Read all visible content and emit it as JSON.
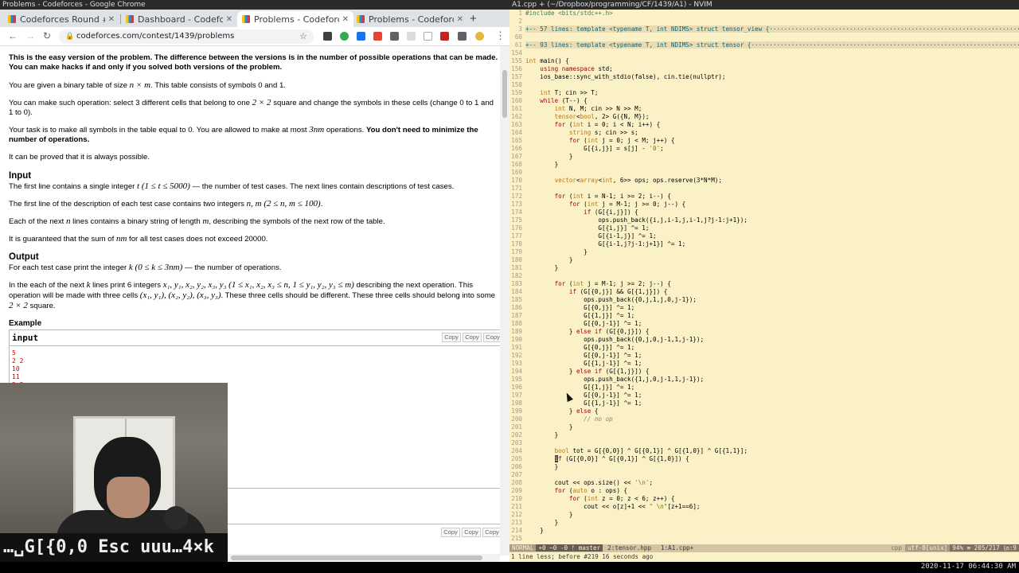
{
  "browser": {
    "window_title": "Problems - Codeforces - Google Chrome",
    "tabs": [
      {
        "label": "Codeforces Round #6",
        "active": false
      },
      {
        "label": "Dashboard - Codeforc",
        "active": false
      },
      {
        "label": "Problems - Codeforce",
        "active": true
      },
      {
        "label": "Problems - Codeforce",
        "active": false
      }
    ],
    "url": "codeforces.com/contest/1439/problems",
    "problem": {
      "p1": "This is the easy version of the problem. The difference between the versions is in the number of possible operations that can be made. You can make hacks if and only if you solved both versions of the problem.",
      "p2a": "You are given a binary table of size ",
      "p2m": "n × m",
      "p2b": ". This table consists of symbols 0 and 1.",
      "p3a": "You can make such operation: select 3 different cells that belong to one ",
      "p3m": "2 × 2",
      "p3b": " square and change the symbols in these cells (change 0 to 1 and 1 to 0).",
      "p4a": "Your task is to make all symbols in the table equal to 0. You are allowed to make at most ",
      "p4m": "3nm",
      "p4b": " operations. ",
      "p4c": "You don't need to minimize the number of operations.",
      "p5": "It can be proved that it is always possible.",
      "input_heading": "Input",
      "i1a": "The first line contains a single integer ",
      "i1m": "t (1 ≤ t ≤ 5000)",
      "i1b": " — the number of test cases. The next lines contain descriptions of test cases.",
      "i2a": "The first line of the description of each test case contains two integers ",
      "i2m": "n, m (2 ≤ n, m ≤ 100)",
      "i2b": ".",
      "i3a": "Each of the next ",
      "i3m": "n",
      "i3b": " lines contains a binary string of length ",
      "i3m2": "m",
      "i3c": ", describing the symbols of the next row of the table.",
      "i4a": "It is guaranteed that the sum of ",
      "i4m": "nm",
      "i4b": " for all test cases does not exceed 20000.",
      "output_heading": "Output",
      "o1a": "For each test case print the integer ",
      "o1m": "k (0 ≤ k ≤ 3nm)",
      "o1b": " — the number of operations.",
      "o2a": "In the each of the next ",
      "o2m": "k",
      "o2b": " lines print 6 integers ",
      "o2m2": "x₁, y₁, x₂, y₂, x₃, y₃ (1 ≤ x₁, x₂, x₃ ≤ n, 1 ≤ y₁, y₂, y₃ ≤ m)",
      "o2c": " describing the next operation. This operation will be made with three cells ",
      "o2m3": "(x₁, y₁), (x₂, y₂), (x₃, y₃)",
      "o2d": ". These three cells should be different. These three cells should belong into some ",
      "o2m4": "2 × 2",
      "o2e": " square.",
      "example_heading": "Example",
      "input_label": "input",
      "copy_label": "Copy",
      "input_lines": "5\n2 2\n10\n11\n3 3"
    }
  },
  "keycast": "…␣G[{0,0 Esc uuu…4×k",
  "nvim": {
    "window_title": "A1.cpp + (~/Dropbox/programming/CF/1439/A1) - NVIM",
    "statusline": {
      "mode": "NORMAL",
      "git": "+0 ~0 -0 ᚠ master",
      "buf2": "2:tensor.hpp",
      "buf1": "1:A1.cpp+",
      "filetype": "cpp",
      "encoding": "utf-8[unix]",
      "position": "94% ≡ 205/217 ㏑:9"
    },
    "cmdline": "1 line less; before #219  16 seconds ago",
    "code": [
      [
        "1",
        "#include <bits/stdc++.h>"
      ],
      [
        "2",
        ""
      ],
      [
        "3",
        "+-- 57 lines: template <typename T, int NDIMS> struct tensor_view {·····································································"
      ],
      [
        "60",
        ""
      ],
      [
        "61",
        "+-- 93 lines: template <typename T, int NDIMS> struct tensor {··········································································"
      ],
      [
        "154",
        ""
      ],
      [
        "155",
        "int main() {"
      ],
      [
        "156",
        "    using namespace std;"
      ],
      [
        "157",
        "    ios_base::sync_with_stdio(false), cin.tie(nullptr);"
      ],
      [
        "158",
        ""
      ],
      [
        "159",
        "    int T; cin >> T;"
      ],
      [
        "160",
        "    while (T--) {"
      ],
      [
        "161",
        "        int N, M; cin >> N >> M;"
      ],
      [
        "162",
        "        tensor<bool, 2> G({N, M});"
      ],
      [
        "163",
        "        for (int i = 0; i < N; i++) {"
      ],
      [
        "164",
        "            string s; cin >> s;"
      ],
      [
        "165",
        "            for (int j = 0; j < M; j++) {"
      ],
      [
        "166",
        "                G[{i,j}] = s[j] - '0';"
      ],
      [
        "167",
        "            }"
      ],
      [
        "168",
        "        }"
      ],
      [
        "169",
        ""
      ],
      [
        "170",
        "        vector<array<int, 6>> ops; ops.reserve(3*N*M);"
      ],
      [
        "171",
        ""
      ],
      [
        "172",
        "        for (int i = N-1; i >= 2; i--) {"
      ],
      [
        "173",
        "            for (int j = M-1; j >= 0; j--) {"
      ],
      [
        "174",
        "                if (G[{i,j}]) {"
      ],
      [
        "175",
        "                    ops.push_back({i,j,i-1,j,i-1,j?j-1:j+1});"
      ],
      [
        "176",
        "                    G[{i,j}] ^= 1;"
      ],
      [
        "177",
        "                    G[{i-1,j}] ^= 1;"
      ],
      [
        "178",
        "                    G[{i-1,j?j-1:j+1}] ^= 1;"
      ],
      [
        "179",
        "                }"
      ],
      [
        "180",
        "            }"
      ],
      [
        "181",
        "        }"
      ],
      [
        "182",
        ""
      ],
      [
        "183",
        "        for (int j = M-1; j >= 2; j--) {"
      ],
      [
        "184",
        "            if (G[{0,j}] && G[{1,j}]) {"
      ],
      [
        "185",
        "                ops.push_back({0,j,1,j,0,j-1});"
      ],
      [
        "186",
        "                G[{0,j}] ^= 1;"
      ],
      [
        "187",
        "                G[{1,j}] ^= 1;"
      ],
      [
        "188",
        "                G[{0,j-1}] ^= 1;"
      ],
      [
        "189",
        "            } else if (G[{0,j}]) {"
      ],
      [
        "190",
        "                ops.push_back({0,j,0,j-1,1,j-1});"
      ],
      [
        "191",
        "                G[{0,j}] ^= 1;"
      ],
      [
        "192",
        "                G[{0,j-1}] ^= 1;"
      ],
      [
        "193",
        "                G[{1,j-1}] ^= 1;"
      ],
      [
        "194",
        "            } else if (G[{1,j}]) {"
      ],
      [
        "195",
        "                ops.push_back({1,j,0,j-1,1,j-1});"
      ],
      [
        "196",
        "                G[{1,j}] ^= 1;"
      ],
      [
        "197",
        "                G[{0,j-1}] ^= 1;"
      ],
      [
        "198",
        "                G[{1,j-1}] ^= 1;"
      ],
      [
        "199",
        "            } else {"
      ],
      [
        "200",
        "                // no op"
      ],
      [
        "201",
        "            }"
      ],
      [
        "202",
        "        }"
      ],
      [
        "203",
        ""
      ],
      [
        "204",
        "        bool tot = G[{0,0}] ^ G[{0,1}] ^ G[{1,0}] ^ G[{1,1}];"
      ],
      [
        "205",
        "        if (G[{0,0}] ^ G[{0,1}] ^ G[{1,0}]) {"
      ],
      [
        "206",
        "        }"
      ],
      [
        "207",
        ""
      ],
      [
        "208",
        "        cout << ops.size() << '\\n';"
      ],
      [
        "209",
        "        for (auto o : ops) {"
      ],
      [
        "210",
        "            for (int z = 0; z < 6; z++) {"
      ],
      [
        "211",
        "                cout << o[z]+1 << \" \\n\"[z+1==6];"
      ],
      [
        "212",
        "            }"
      ],
      [
        "213",
        "        }"
      ],
      [
        "214",
        "    }"
      ],
      [
        "215",
        ""
      ]
    ]
  },
  "clock": "2020-11-17 06:44:30 AM"
}
